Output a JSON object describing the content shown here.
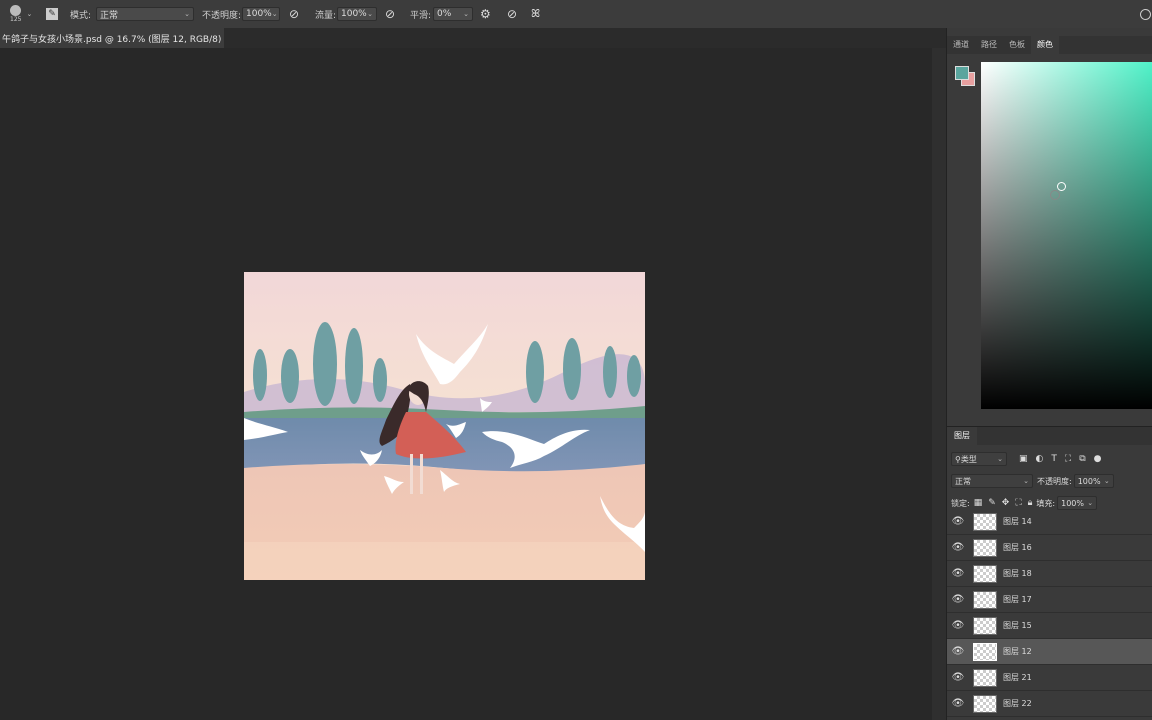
{
  "toolbar": {
    "brush_size": "125",
    "mode_label": "模式:",
    "mode_value": "正常",
    "opacity_label": "不透明度:",
    "opacity_value": "100%",
    "flow_label": "流量:",
    "flow_value": "100%",
    "smoothing_label": "平滑:",
    "smoothing_value": "0%"
  },
  "document": {
    "tab_title": "午鸽子与女孩小场景.psd @ 16.7% (图层 12, RGB/8) *"
  },
  "right_panel": {
    "tabs": [
      "通道",
      "路径",
      "色板",
      "颜色"
    ],
    "active_tab": "颜色",
    "foreground_color": "#5aa59e",
    "background_color": "#e8a0a0"
  },
  "layers_panel": {
    "title": "图层",
    "filter_label": "类型",
    "blend_mode": "正常",
    "opacity_label": "不透明度:",
    "opacity_value": "100%",
    "lock_label": "锁定:",
    "fill_label": "填充:",
    "fill_value": "100%",
    "layers": [
      {
        "name": "图层 14",
        "selected": false
      },
      {
        "name": "图层 16",
        "selected": false
      },
      {
        "name": "图层 18",
        "selected": false
      },
      {
        "name": "图层 17",
        "selected": false
      },
      {
        "name": "图层 15",
        "selected": false
      },
      {
        "name": "图层 12",
        "selected": true
      },
      {
        "name": "图层 21",
        "selected": false
      },
      {
        "name": "图层 22",
        "selected": false
      }
    ]
  },
  "colors": {
    "ui_bg": "#282828",
    "panel_bg": "#3a3a3a",
    "accent_teal": "#5aa59e"
  }
}
